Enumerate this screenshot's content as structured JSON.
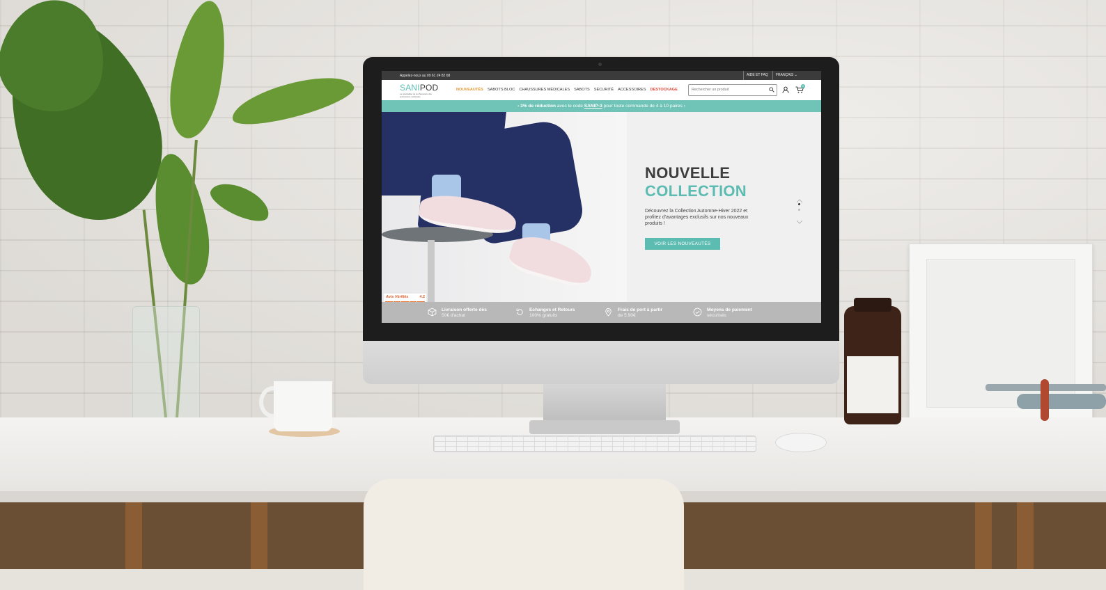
{
  "site": {
    "topbar": {
      "phone_text": "Appelez-nous au 09 61 24 82 68",
      "help_label": "AIDE ET FAQ",
      "language_label": "FRANÇAIS"
    },
    "logo": {
      "part1": "SANI",
      "part2": "POD",
      "tagline": "Le spécialiste de la chaussure des professions médicales"
    },
    "nav": {
      "items": [
        "NOUVEAUTÉS",
        "SABOTS BLOC",
        "CHAUSSURES MÉDICALES",
        "SABOTS",
        "SÉCURITÉ",
        "ACCESSOIRES",
        "DESTOCKAGE"
      ]
    },
    "search": {
      "placeholder": "Rechercher un produit"
    },
    "cart": {
      "count": "0"
    },
    "promo": {
      "prefix_arrow": "‹",
      "bold_text": "3% de réduction",
      "middle_text": " avec le code ",
      "code": "SANIP-3",
      "suffix_text": " pour toute commande de 4 à 10 paires",
      "suffix_arrow": "›"
    },
    "hero": {
      "title_line1": "NOUVELLE",
      "title_line2": "COLLECTION",
      "description": "Découvrez la Collection Automne-Hiver 2022 et profitez d'avantages exclusifs sur nos nouveaux produits !",
      "cta_label": "VOIR LES NOUVEAUTÉS"
    },
    "review": {
      "brand": "Avis Vérifiés",
      "score": "4.2",
      "stars": [
        "★",
        "★",
        "★",
        "★",
        "★"
      ]
    },
    "features": [
      {
        "title": "Livraison offerte dès",
        "sub": "50€ d'achat",
        "icon": "box-icon"
      },
      {
        "title": "Echanges et Retours",
        "sub": "100% gratuits",
        "icon": "return-icon"
      },
      {
        "title": "Frais de port à partir",
        "sub": "de 5.90€",
        "icon": "location-icon"
      },
      {
        "title": "Moyens de paiement",
        "sub": "sécurisés",
        "icon": "check-shield-icon"
      }
    ]
  },
  "colors": {
    "brand_teal": "#5cbcb2",
    "promo_bar": "#6fc4b7",
    "nav_active": "#e39a34",
    "nav_sale": "#e0473c",
    "topbar": "#3b3b3b"
  }
}
